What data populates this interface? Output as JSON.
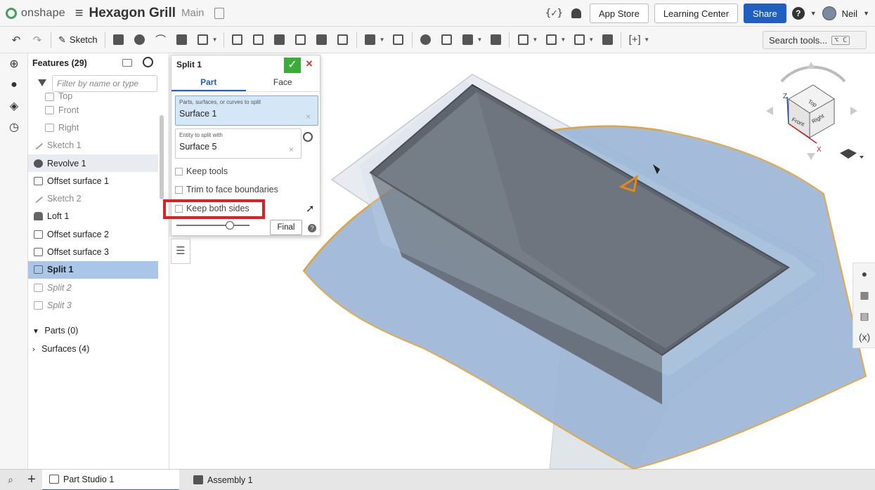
{
  "header": {
    "logo_text": "onshape",
    "doc_title": "Hexagon Grill",
    "branch": "Main",
    "code_icon": "{✓}",
    "app_store": "App Store",
    "learning_center": "Learning Center",
    "share": "Share",
    "help": "?",
    "user": "Neil"
  },
  "toolbar": {
    "sketch_label": "Sketch",
    "search_label": "Search tools...",
    "search_shortcut": "⌥ C"
  },
  "features": {
    "header": "Features (29)",
    "filter_placeholder": "Filter by name or type",
    "items": [
      {
        "label": "Top"
      },
      {
        "label": "Front"
      },
      {
        "label": "Right"
      },
      {
        "label": "Sketch 1"
      },
      {
        "label": "Revolve 1"
      },
      {
        "label": "Offset surface 1"
      },
      {
        "label": "Sketch 2"
      },
      {
        "label": "Loft 1"
      },
      {
        "label": "Offset surface 2"
      },
      {
        "label": "Offset surface 3"
      },
      {
        "label": "Split 1"
      },
      {
        "label": "Split 2"
      },
      {
        "label": "Split 3"
      }
    ],
    "parts_label": "Parts (0)",
    "surfaces_label": "Surfaces (4)"
  },
  "dialog": {
    "title": "Split 1",
    "tab_part": "Part",
    "tab_face": "Face",
    "field1_label": "Parts, surfaces, or curves to split",
    "field1_value": "Surface 1",
    "field2_label": "Entity to split with",
    "field2_value": "Surface 5",
    "keep_tools": "Keep tools",
    "trim_to_face": "Trim to face boundaries",
    "keep_both_sides": "Keep both sides",
    "final": "Final",
    "clear_mark": "×"
  },
  "viewcube": {
    "top": "Top",
    "front": "Front",
    "right": "Right",
    "z_axis": "Z",
    "x_axis": "X"
  },
  "bottom_tabs": {
    "part_studio": "Part Studio 1",
    "assembly": "Assembly 1"
  }
}
